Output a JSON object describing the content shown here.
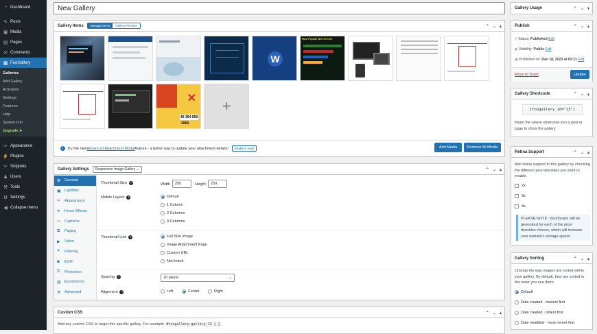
{
  "sidebar": {
    "items": [
      {
        "label": "Dashboard",
        "icon": "dashboard-icon"
      },
      {
        "label": "Posts",
        "icon": "pin-icon"
      },
      {
        "label": "Media",
        "icon": "media-icon"
      },
      {
        "label": "Pages",
        "icon": "pages-icon"
      },
      {
        "label": "Comments",
        "icon": "comments-icon"
      },
      {
        "label": "FooGallery",
        "icon": "foogallery-icon"
      }
    ],
    "submenu": [
      "Galleries",
      "Add Gallery",
      "Activation",
      "Settings",
      "Features",
      "Help",
      "System Info",
      "Upgrade ➤"
    ],
    "items2": [
      {
        "label": "Appearance",
        "icon": "brush-icon"
      },
      {
        "label": "Plugins",
        "icon": "plugins-icon"
      },
      {
        "label": "Snippets",
        "icon": "snippets-icon"
      },
      {
        "label": "Users",
        "icon": "users-icon"
      },
      {
        "label": "Tools",
        "icon": "tools-icon"
      },
      {
        "label": "Settings",
        "icon": "settings-icon"
      }
    ],
    "collapse": "Collapse menu"
  },
  "title": "New Gallery",
  "gallery_items": {
    "title": "Gallery Items",
    "manage": "Manage Items",
    "preview": "Gallery Preview",
    "notice_pre": "Try the new ",
    "notice_link": "Advanced Attachment Modal",
    "notice_post": " feature - a better way to update your attachment details!",
    "enable": "Enable it now!",
    "add_media": "Add Media",
    "remove_all": "Remove All Media",
    "thumb_text": {
      "chart1": "46 364 958",
      "chart2": "2069",
      "popular": "Most Popular Web Servers"
    }
  },
  "settings": {
    "title": "Gallery Settings",
    "template": "Responsive Image Gallery",
    "tabs": [
      "General",
      "Lightbox",
      "Appearance",
      "Hover Effects",
      "Captions",
      "Paging",
      "Video",
      "Filtering",
      "EXIF",
      "Protection",
      "Ecommerce",
      "Advanced"
    ],
    "thumb_size": "Thumbnail Size",
    "width_label": "Width",
    "width": "250",
    "height_label": "Height",
    "height": "250",
    "mobile_layout": "Mobile Layout",
    "mobile_opts": [
      "Default",
      "1 Column",
      "2 Columns",
      "3 Columns"
    ],
    "thumb_link": "Thumbnail Link",
    "link_opts": [
      "Full Size Image",
      "Image Attachment Page",
      "Custom URL",
      "Not linked"
    ],
    "spacing": "Spacing",
    "spacing_val": "10 pixels",
    "alignment": "Alignment",
    "align_opts": [
      "Left",
      "Center",
      "Right"
    ]
  },
  "custom_css": {
    "title": "Custom CSS",
    "text": "Add any custom CSS to target this specific gallery. For example",
    "code": "#foogallery-gallery-13 { }"
  },
  "right": {
    "usage": "Gallery Usage",
    "publish": {
      "title": "Publish",
      "status_l": "Status: ",
      "status": "Published",
      "visibility_l": "Visibility: ",
      "visibility": "Public",
      "published_l": "Published on: ",
      "published": "Dec 18, 2023 at 02:11",
      "edit": "Edit",
      "trash": "Move to Trash",
      "update": "Update"
    },
    "shortcode": {
      "title": "Gallery Shortcode",
      "code": "[foogallery id=\"13\"]",
      "text": "Paste the above shortcode into a post or page to show the gallery."
    },
    "retina": {
      "title": "Retina Support",
      "text": "Add retina support to this gallery by choosing the different pixel densities you want to enable.",
      "opts": [
        "2x",
        "3x",
        "4x"
      ],
      "note": "PLEASE NOTE : thumbnails will be generated for each of the pixel densities chosen, which will increase your website's storage space!"
    },
    "sorting": {
      "title": "Gallery Sorting",
      "text": "Change the way images are sorted within your gallery. By default, they are sorted in the order you see them.",
      "opts": [
        "Default",
        "Date created - newest first",
        "Date created - oldest first",
        "Date modified - most recent first"
      ]
    }
  }
}
